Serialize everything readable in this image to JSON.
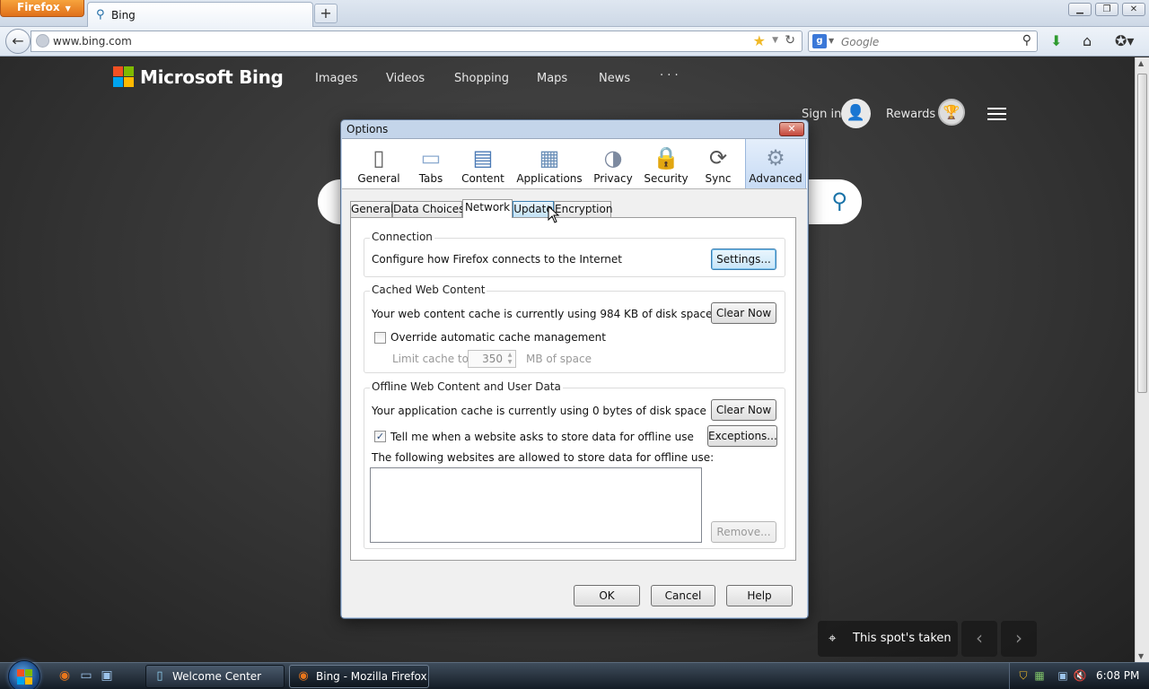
{
  "browser": {
    "firefox_button": "Firefox",
    "tab_title": "Bing",
    "new_tab_label": "+",
    "url": "www.bing.com",
    "search_placeholder": "Google",
    "search_engine_icon": "google-icon"
  },
  "bing": {
    "logo_text": "Microsoft Bing",
    "nav": [
      "Images",
      "Videos",
      "Shopping",
      "Maps",
      "News",
      "· · ·"
    ],
    "sign_in": "Sign in",
    "rewards": "Rewards",
    "spot_text": "This spot's taken"
  },
  "dialog": {
    "title": "Options",
    "panes": [
      {
        "label": "General",
        "icon": "general-icon"
      },
      {
        "label": "Tabs",
        "icon": "tabs-icon"
      },
      {
        "label": "Content",
        "icon": "content-icon"
      },
      {
        "label": "Applications",
        "icon": "applications-icon"
      },
      {
        "label": "Privacy",
        "icon": "privacy-mask-icon"
      },
      {
        "label": "Security",
        "icon": "padlock-icon"
      },
      {
        "label": "Sync",
        "icon": "sync-icon"
      },
      {
        "label": "Advanced",
        "icon": "gear-icon",
        "selected": true
      }
    ],
    "subtabs": [
      "General",
      "Data Choices",
      "Network",
      "Update",
      "Encryption"
    ],
    "active_subtab": "Network",
    "connection": {
      "label": "Connection",
      "text": "Configure how Firefox connects to the Internet",
      "button": "Settings..."
    },
    "cache": {
      "label": "Cached Web Content",
      "text": "Your web content cache is currently using 984 KB of disk space",
      "button": "Clear Now",
      "override_label": "Override automatic cache management",
      "override_checked": false,
      "limit_label": "Limit cache to",
      "limit_value": "350",
      "limit_unit": "MB of space"
    },
    "offline": {
      "label": "Offline Web Content and User Data",
      "text": "Your application cache is currently using 0 bytes of disk space",
      "button": "Clear Now",
      "tell_me_label": "Tell me when a website asks to store data for offline use",
      "tell_me_checked": true,
      "exceptions_button": "Exceptions...",
      "list_label": "The following websites are allowed to store data for offline use:",
      "remove_button": "Remove..."
    },
    "buttons": {
      "ok": "OK",
      "cancel": "Cancel",
      "help": "Help"
    }
  },
  "taskbar": {
    "tasks": [
      "Welcome Center",
      "Bing - Mozilla Firefox"
    ],
    "clock": "6:08 PM"
  }
}
